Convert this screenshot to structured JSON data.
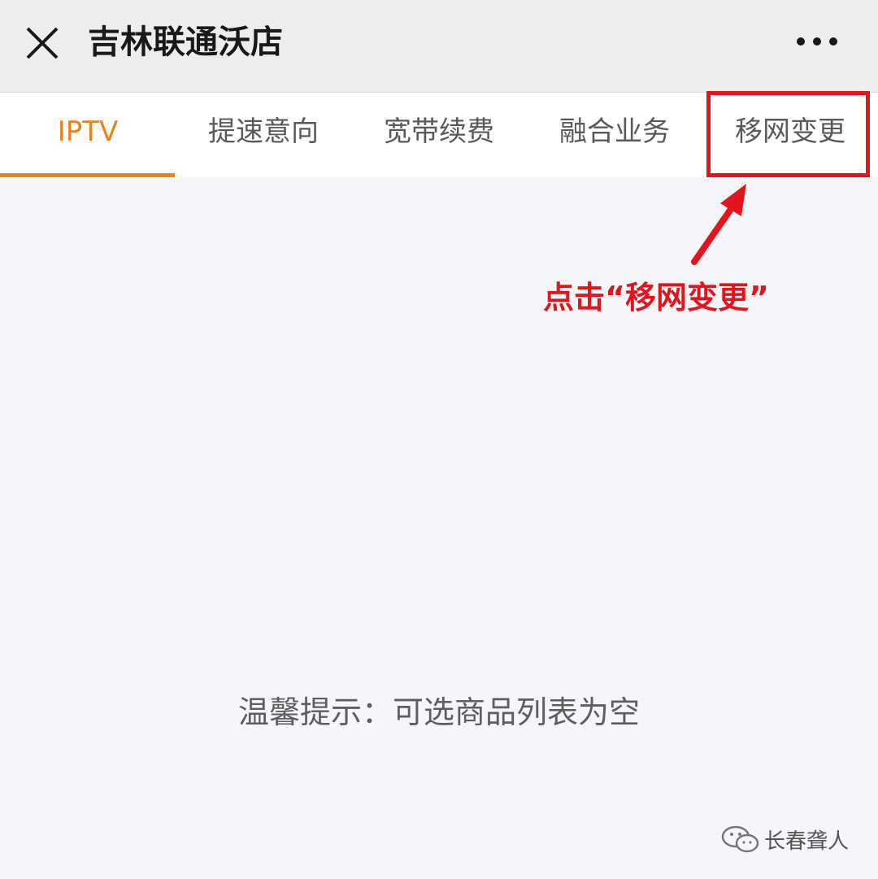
{
  "header": {
    "title": "吉林联通沃店",
    "close_icon": "close-icon",
    "more_icon": "more-dots-icon"
  },
  "tabs": [
    {
      "label": "IPTV",
      "active": true
    },
    {
      "label": "提速意向",
      "active": false
    },
    {
      "label": "宽带续费",
      "active": false
    },
    {
      "label": "融合业务",
      "active": false
    },
    {
      "label": "移网变更",
      "active": false
    }
  ],
  "annotation": {
    "text": "点击“移网变更”",
    "color": "#e2141c"
  },
  "main": {
    "empty_tip": "温馨提示：可选商品列表为空"
  },
  "watermark": {
    "text": "长春聋人",
    "icon": "wechat-icon"
  },
  "colors": {
    "accent": "#e8821e",
    "annotation_red": "#e2141c",
    "background": "#f4f6fa"
  }
}
